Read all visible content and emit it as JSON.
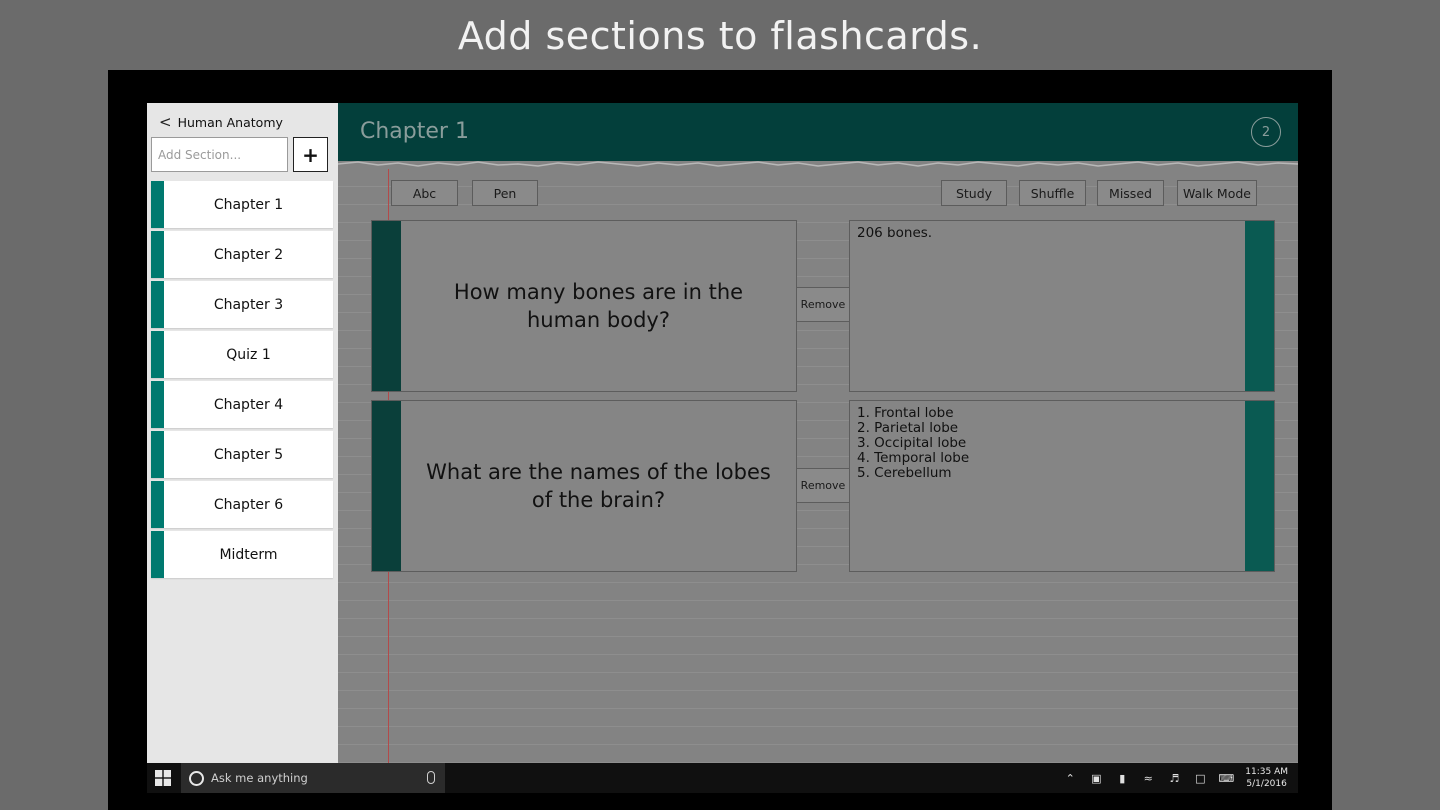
{
  "banner": "Add sections to flashcards.",
  "sidebar": {
    "back_label": "Human Anatomy",
    "add_placeholder": "Add Section...",
    "add_button": "+",
    "sections": [
      "Chapter 1",
      "Chapter 2",
      "Chapter 3",
      "Quiz 1",
      "Chapter 4",
      "Chapter 5",
      "Chapter 6",
      "Midterm"
    ]
  },
  "header": {
    "title": "Chapter 1",
    "badge": "2"
  },
  "toolbar": {
    "abc": "Abc",
    "pen": "Pen",
    "study": "Study",
    "shuffle": "Shuffle",
    "missed": "Missed",
    "walk_mode": "Walk Mode"
  },
  "cards": [
    {
      "question": "How many bones are in the human body?",
      "answer": "206 bones.",
      "remove": "Remove"
    },
    {
      "question": "What are the names of the lobes of the brain?",
      "answer": "1. Frontal lobe\n2. Parietal lobe\n3. Occipital lobe\n4. Temporal lobe\n5. Cerebellum",
      "remove": "Remove"
    }
  ],
  "taskbar": {
    "search_placeholder": "Ask me anything",
    "time": "11:35 AM",
    "date": "5/1/2016"
  },
  "colors": {
    "accent": "#00796f",
    "header": "#033f3b",
    "banner_bg": "#6b6b6b"
  }
}
